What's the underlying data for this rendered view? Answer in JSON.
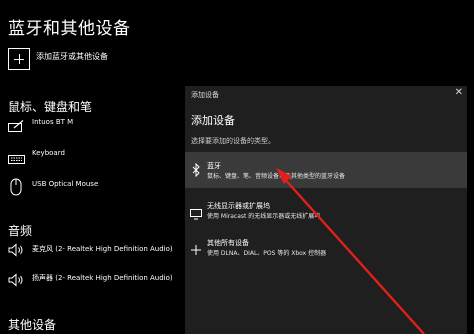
{
  "page": {
    "title": "蓝牙和其他设备",
    "add_bluetooth_label": "添加蓝牙或其他设备"
  },
  "sections": {
    "mouse_keyboard_pen": {
      "title": "鼠标、键盘和笔",
      "devices": [
        "Intuos BT M",
        "Keyboard",
        "USB Optical Mouse"
      ]
    },
    "audio": {
      "title": "音频",
      "devices": [
        "麦克风 (2- Realtek High Definition Audio)",
        "扬声器 (2- Realtek High Definition Audio)"
      ]
    },
    "other_devices": {
      "title": "其他设备"
    }
  },
  "dialog": {
    "title": "添加设备",
    "close_glyph": "✕",
    "heading": "添加设备",
    "subtitle": "选择要添加的设备的类型。",
    "options": [
      {
        "title": "蓝牙",
        "desc": "鼠标、键盘、笔、音频设备以及其他类型的蓝牙设备",
        "icon": "bluetooth-icon"
      },
      {
        "title": "无线显示器或扩展坞",
        "desc": "使用 Miracast 的无线显示器或无线扩展坞",
        "icon": "monitor-icon"
      },
      {
        "title": "其他所有设备",
        "desc": "使用 DLNA、DIAL、POS 等的 Xbox 控制器",
        "icon": "plus-icon"
      }
    ]
  },
  "colors": {
    "background": "#000000",
    "dialog": "#1f1f1f",
    "selected_option": "#3a3a3a",
    "annotation_arrow": "#e0201a"
  }
}
